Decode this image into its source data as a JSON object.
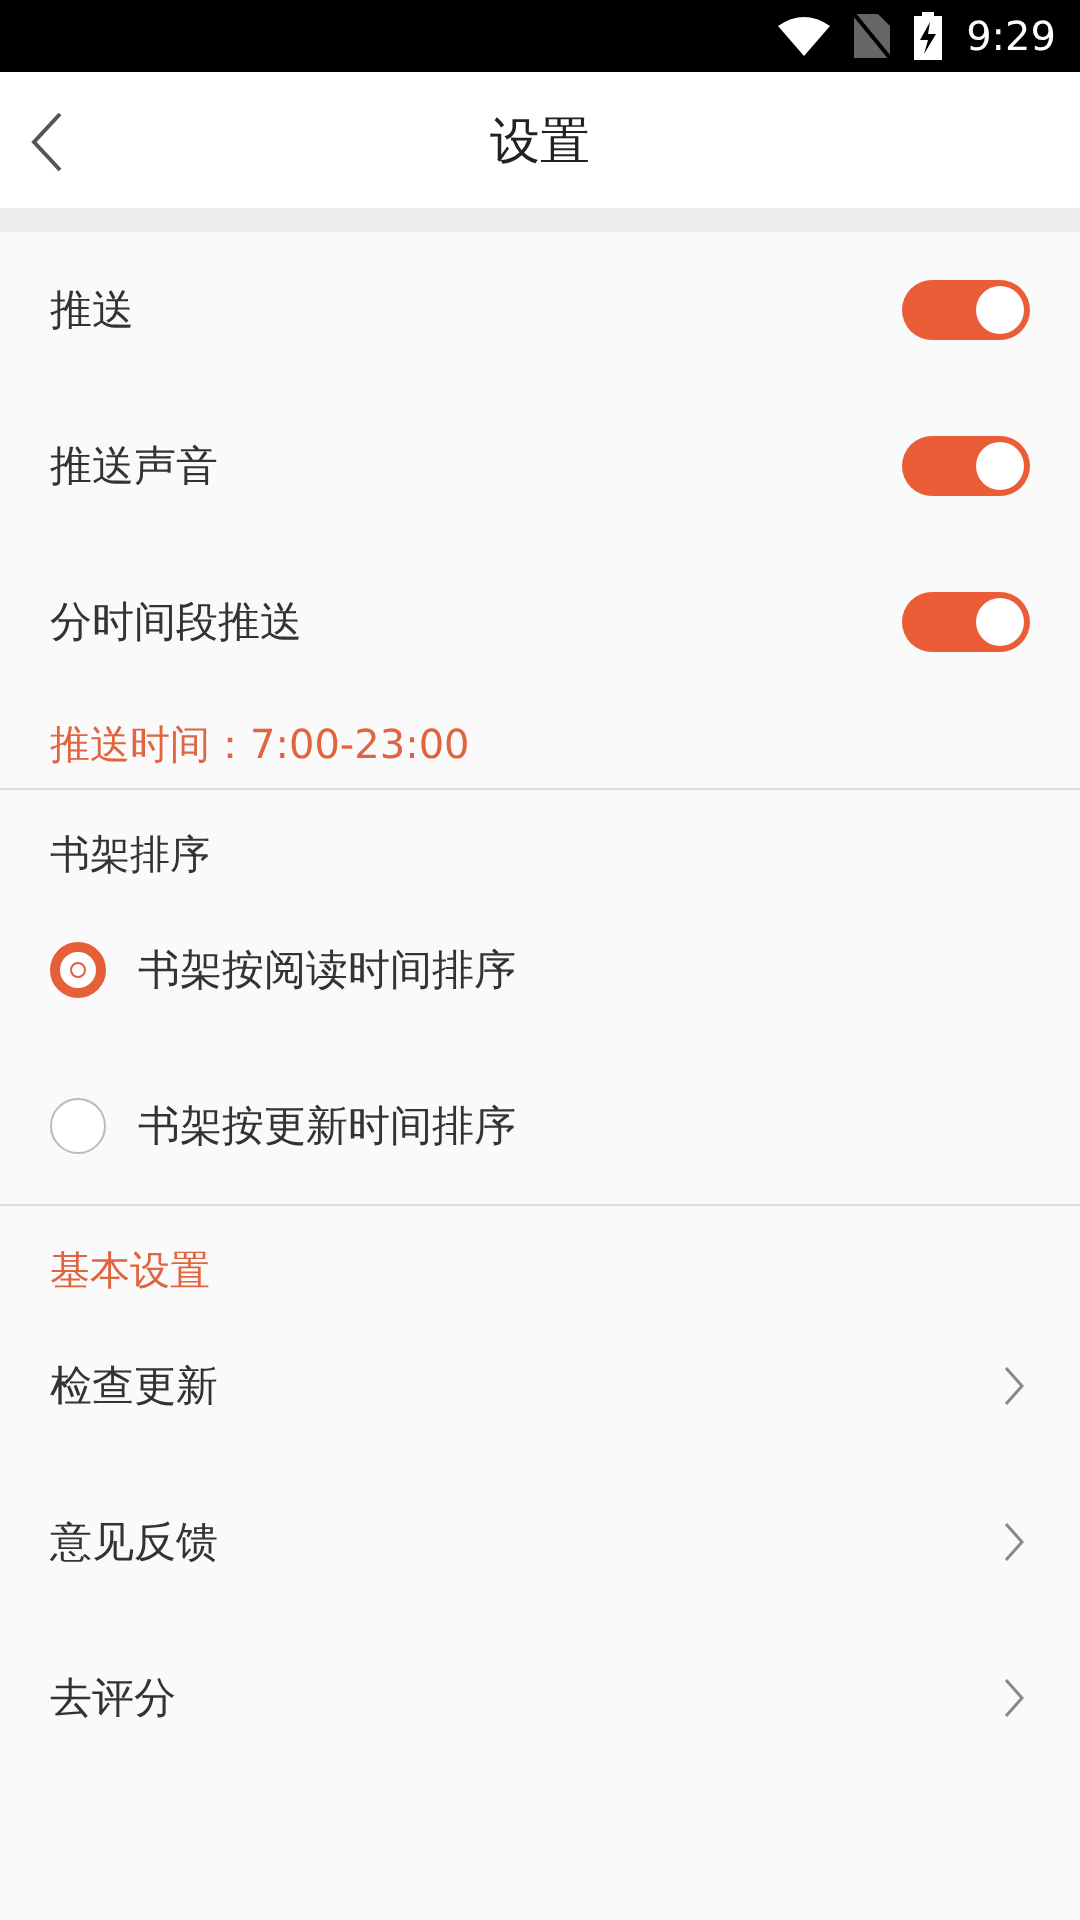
{
  "status_bar": {
    "time": "9:29"
  },
  "header": {
    "title": "设置"
  },
  "push_settings": {
    "toggles": [
      {
        "label": "推送",
        "on": true
      },
      {
        "label": "推送声音",
        "on": true
      },
      {
        "label": "分时间段推送",
        "on": true
      }
    ],
    "push_time": "推送时间：7:00-23:00"
  },
  "shelf_sort": {
    "title": "书架排序",
    "options": [
      {
        "label": "书架按阅读时间排序",
        "selected": true
      },
      {
        "label": "书架按更新时间排序",
        "selected": false
      }
    ]
  },
  "basic_settings": {
    "title": "基本设置",
    "items": [
      {
        "label": "检查更新"
      },
      {
        "label": "意见反馈"
      },
      {
        "label": "去评分"
      }
    ]
  }
}
